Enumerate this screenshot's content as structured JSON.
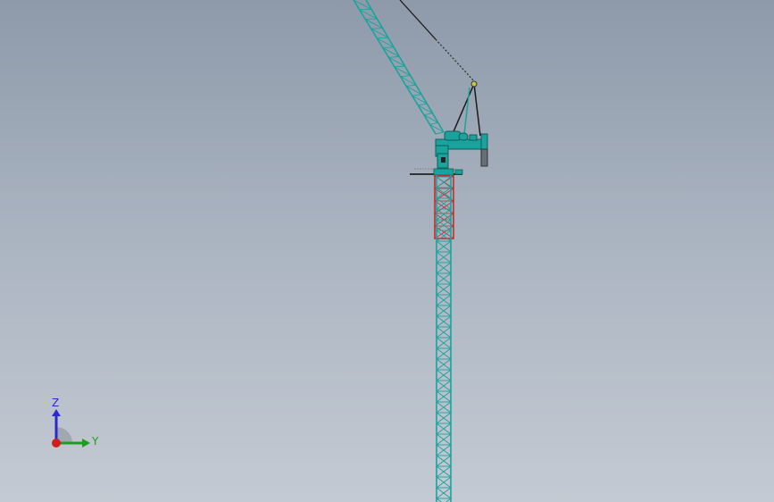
{
  "viewport": {
    "background_top": "#8e9aaa",
    "background_bottom": "#c4cad3"
  },
  "model": {
    "tower_color": "#1aa39c",
    "climbing_frame_color": "#cc2a2a",
    "boom_color": "#1aa39c",
    "cable_color": "#1a1a1a",
    "counterweight_color": "#666e78"
  },
  "triad": {
    "z_label": "Z",
    "y_label": "Y",
    "z_color": "#2a2ad0",
    "y_color": "#1e9e1e",
    "x_color": "#d01e1e"
  }
}
